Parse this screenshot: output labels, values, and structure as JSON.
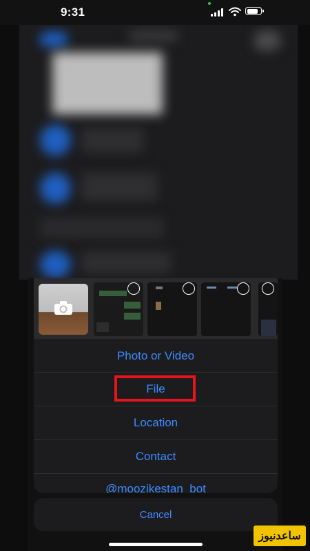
{
  "status_bar": {
    "time": "9:31",
    "battery_level": 0.85
  },
  "attachment_sheet": {
    "menu_items": [
      "Photo or Video",
      "File",
      "Location",
      "Contact",
      "@moozikestan_bot"
    ],
    "cancel_label": "Cancel",
    "highlighted_item": "File",
    "accent_color": "#3d8bff",
    "highlight_color": "#e8141c"
  },
  "icons": [
    "camera-icon",
    "signal-icon",
    "wifi-icon",
    "battery-icon"
  ],
  "watermark": {
    "text": "ساعدنیوز"
  }
}
